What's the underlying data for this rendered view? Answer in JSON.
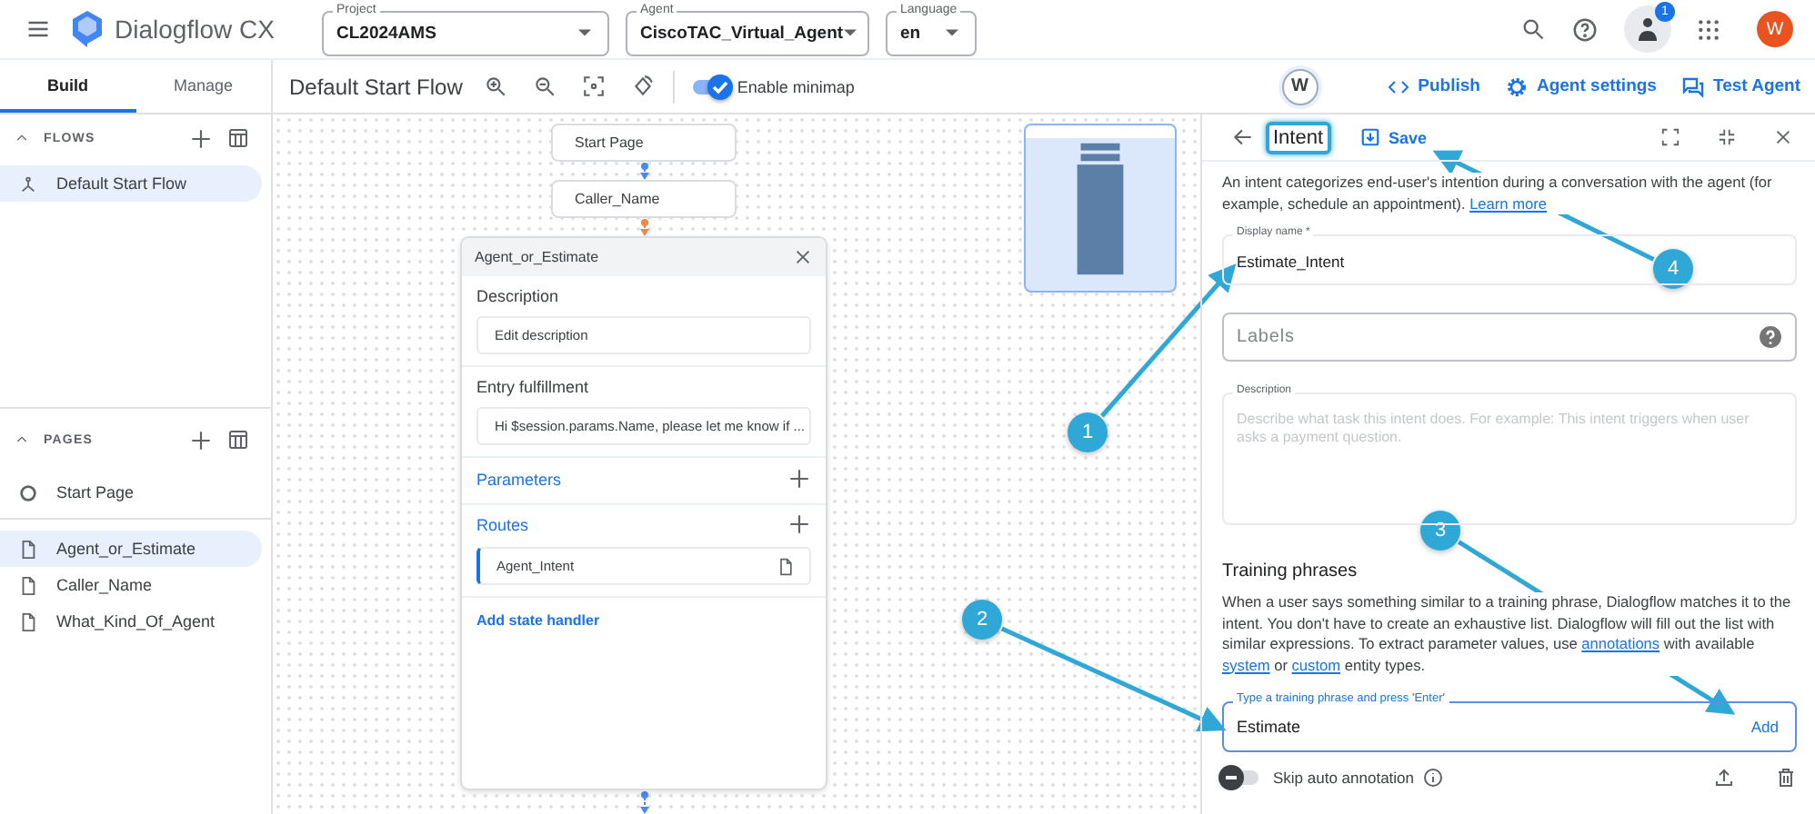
{
  "app": {
    "title": "Dialogflow CX"
  },
  "selectors": [
    {
      "label": "Project",
      "value": "CL2024AMS"
    },
    {
      "label": "Agent",
      "value": "CiscoTAC_Virtual_Agent"
    },
    {
      "label": "Language",
      "value": "en"
    }
  ],
  "header": {
    "notification_count": "1",
    "avatar": "W"
  },
  "sidebar": {
    "tabs": [
      {
        "label": "Build",
        "selected": true
      },
      {
        "label": "Manage",
        "selected": false
      }
    ],
    "flows": {
      "title": "FLOWS",
      "items": [
        {
          "label": "Default Start Flow",
          "kind": "flow",
          "selected": true
        }
      ]
    },
    "pages": {
      "title": "PAGES",
      "items": [
        {
          "label": "Start Page",
          "kind": "start",
          "selected": false
        },
        {
          "label": "Agent_or_Estimate",
          "kind": "page",
          "selected": true
        },
        {
          "label": "Caller_Name",
          "kind": "page",
          "selected": false
        },
        {
          "label": "What_Kind_Of_Agent",
          "kind": "page",
          "selected": false
        }
      ]
    }
  },
  "toolbar": {
    "flow_title": "Default Start Flow",
    "minimap": {
      "label": "Enable minimap",
      "on": true
    },
    "user_initial": "W",
    "actions": [
      {
        "label": "Publish",
        "kind": "code"
      },
      {
        "label": "Agent settings",
        "kind": "gear"
      },
      {
        "label": "Test Agent",
        "kind": "chat"
      }
    ]
  },
  "canvas": {
    "nodes": [
      {
        "label": "Start Page"
      },
      {
        "label": "Caller_Name"
      }
    ],
    "page_panel": {
      "title": "Agent_or_Estimate",
      "description_label": "Description",
      "description_value": "Edit description",
      "fulfillment_label": "Entry fulfillment",
      "fulfillment_value": "Hi $session.params.Name, please let me know if ...",
      "parameters_label": "Parameters",
      "routes_label": "Routes",
      "routes": [
        {
          "label": "Agent_Intent"
        }
      ],
      "add_handler": "Add state handler"
    }
  },
  "intent_panel": {
    "title": "Intent",
    "save": "Save",
    "intro": [
      {
        "text": "An intent categorizes end-user's intention during a conversation with the agent (for example, schedule an appointment). "
      },
      {
        "link": "Learn more"
      }
    ],
    "display_name": {
      "label": "Display name *",
      "value": "Estimate_Intent"
    },
    "labels": {
      "placeholder": "Labels"
    },
    "description": {
      "label": "Description",
      "placeholder": "Describe what task this intent does. For example: This intent triggers when user asks a payment question."
    },
    "training_title": "Training phrases",
    "training_help": [
      {
        "text": "When a user says something similar to a training phrase, Dialogflow matches it to the intent. You don't have to create an exhaustive list. Dialogflow will fill out the list with similar expressions. To extract parameter values, use "
      },
      {
        "link": "annotations"
      },
      {
        "text": " with available "
      },
      {
        "link": "system"
      },
      {
        "text": " or "
      },
      {
        "link": "custom"
      },
      {
        "text": " entity types."
      }
    ],
    "training_input": {
      "label": "Type a training phrase and press 'Enter'",
      "value": "Estimate",
      "action": "Add"
    },
    "skip_annotation": {
      "label": "Skip auto annotation",
      "on": false
    }
  },
  "callouts": [
    {
      "number": "1"
    },
    {
      "number": "2"
    },
    {
      "number": "3"
    },
    {
      "number": "4"
    }
  ]
}
